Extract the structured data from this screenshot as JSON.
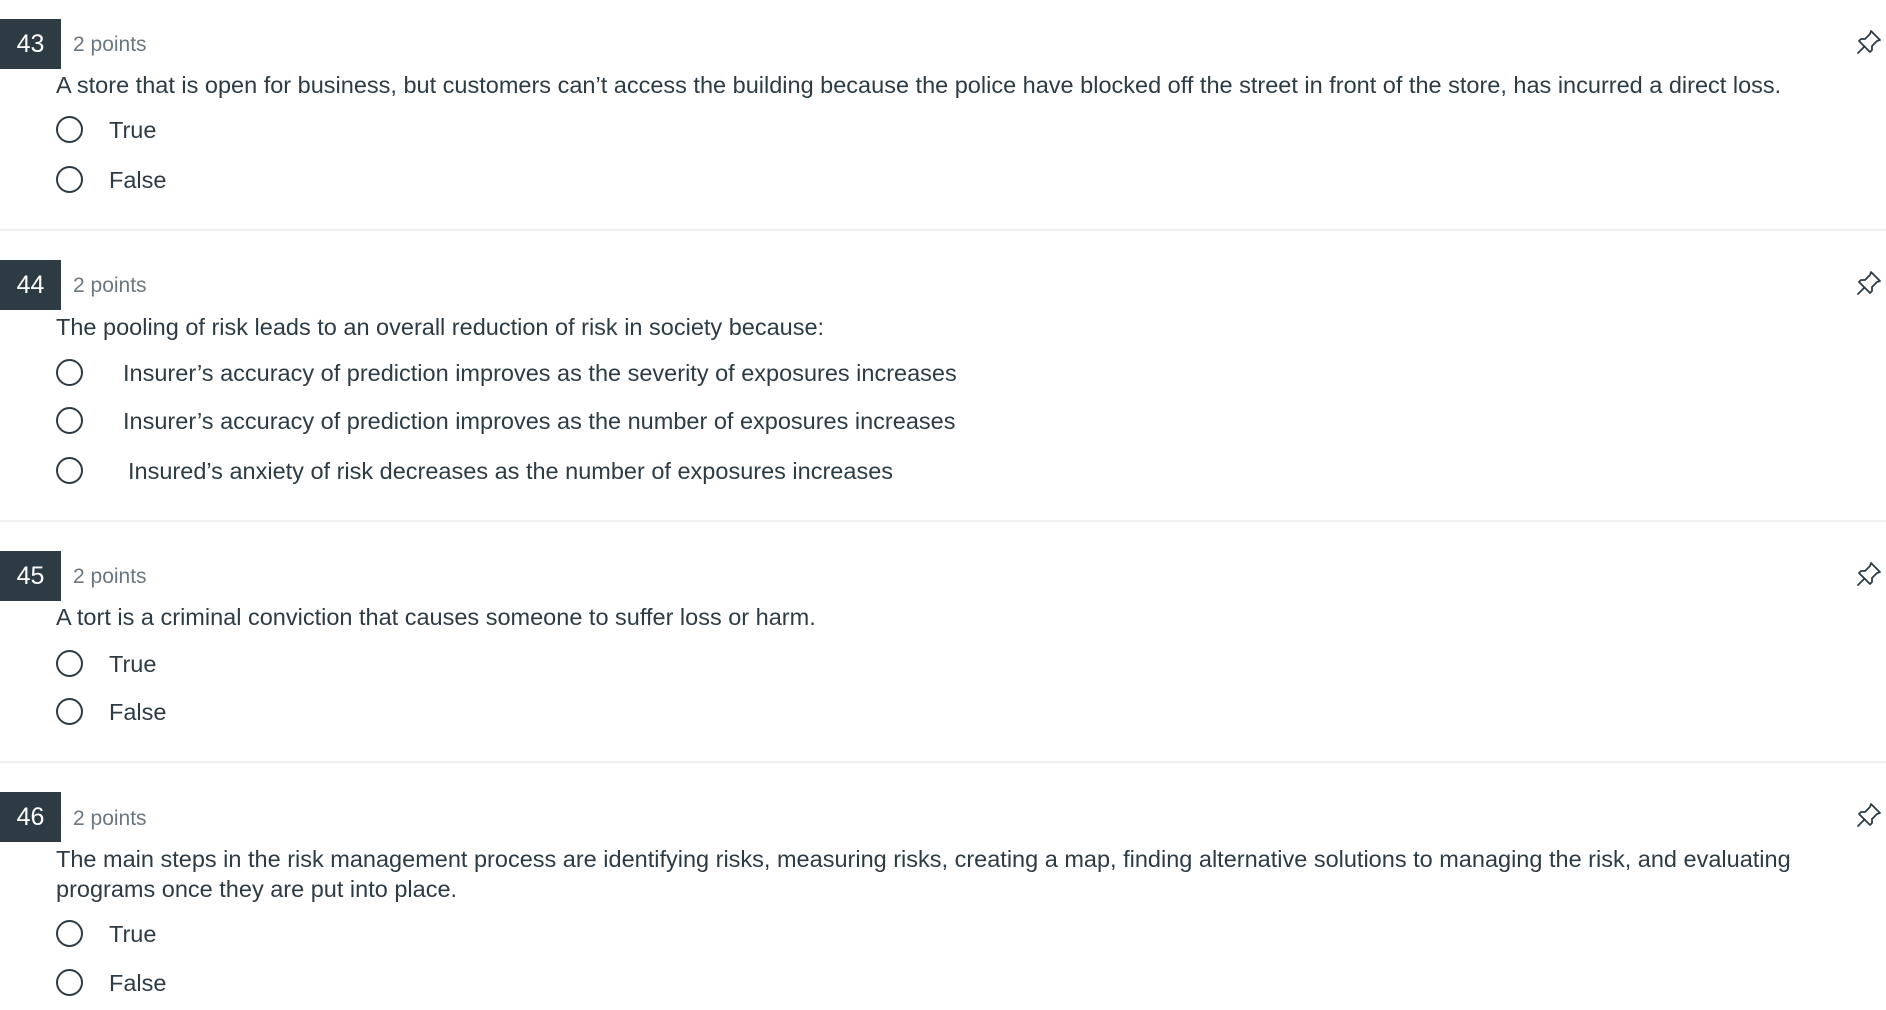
{
  "questions": [
    {
      "number": "43",
      "points": "2 points",
      "text": "A store that is open for business, but customers can’t access the building because the police have blocked off the street in front of the store, has incurred a direct loss.",
      "answers": [
        "True",
        "False"
      ]
    },
    {
      "number": "44",
      "points": "2 points",
      "text": "The pooling of risk leads to an overall reduction of risk in society because:",
      "answers": [
        "Insurer’s accuracy of prediction improves as the severity of exposures increases",
        "Insurer’s accuracy of prediction improves as the number of exposures increases",
        "Insured’s anxiety of risk decreases as the number of exposures increases"
      ]
    },
    {
      "number": "45",
      "points": "2 points",
      "text": "A tort is a criminal conviction that causes someone to suffer loss or harm.",
      "answers": [
        "True",
        "False"
      ]
    },
    {
      "number": "46",
      "points": "2 points",
      "text": "The main steps in the risk management process are identifying risks, measuring risks, creating a map, finding alternative solutions to managing the risk, and evaluating programs once they are put into place.",
      "answers": [
        "True",
        "False"
      ]
    }
  ],
  "icons": {
    "pin": "pin-icon",
    "radio": "radio-unselected-icon"
  },
  "colors": {
    "question_number_bg": "#2d3b45",
    "text": "#2d3b45",
    "points_text": "#6b7780",
    "divider": "#eef0f1"
  }
}
